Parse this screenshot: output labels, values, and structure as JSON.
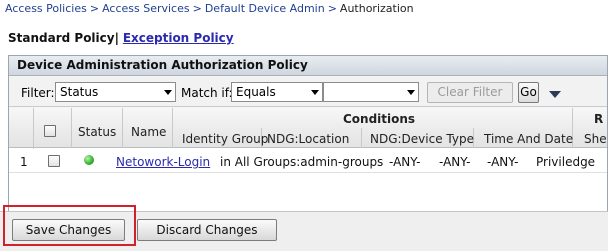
{
  "breadcrumb": {
    "items": [
      "Access Policies",
      "Access Services",
      "Default Device Admin"
    ],
    "separator": ">",
    "current": "Authorization"
  },
  "policy_tabs": {
    "active": "Standard Policy",
    "divider": "|",
    "link": "Exception Policy"
  },
  "panel": {
    "title": "Device Administration Authorization Policy"
  },
  "filter": {
    "filter_label": "Filter:",
    "filter_value": "Status",
    "match_label": "Match if:",
    "match_value": "Equals",
    "value_field": "",
    "clear_button": "Clear Filter",
    "go_button": "Go",
    "options_icon": "caret-down-icon"
  },
  "table": {
    "headers": {
      "status": "Status",
      "name": "Name",
      "conditions": "Conditions",
      "identity_group": "Identity Group",
      "ndg_location": "NDG:Location",
      "ndg_device_type": "NDG:Device Type",
      "time_and_date": "Time And Date",
      "results_partial": "R",
      "shell_partial": "She"
    },
    "rows": [
      {
        "index": "1",
        "status": "enabled",
        "name": "Netowork-Login",
        "identity_group": "in All Groups:admin-groups",
        "ndg_location": "-ANY-",
        "ndg_device_type": "-ANY-",
        "time_and_date": "-ANY-",
        "shell": "Priviledge"
      }
    ]
  },
  "actions": {
    "save": "Save Changes",
    "discard": "Discard Changes"
  },
  "colors": {
    "link": "#2a2ab0",
    "highlight": "#d4202a",
    "status_ok": "#2fae2a"
  }
}
